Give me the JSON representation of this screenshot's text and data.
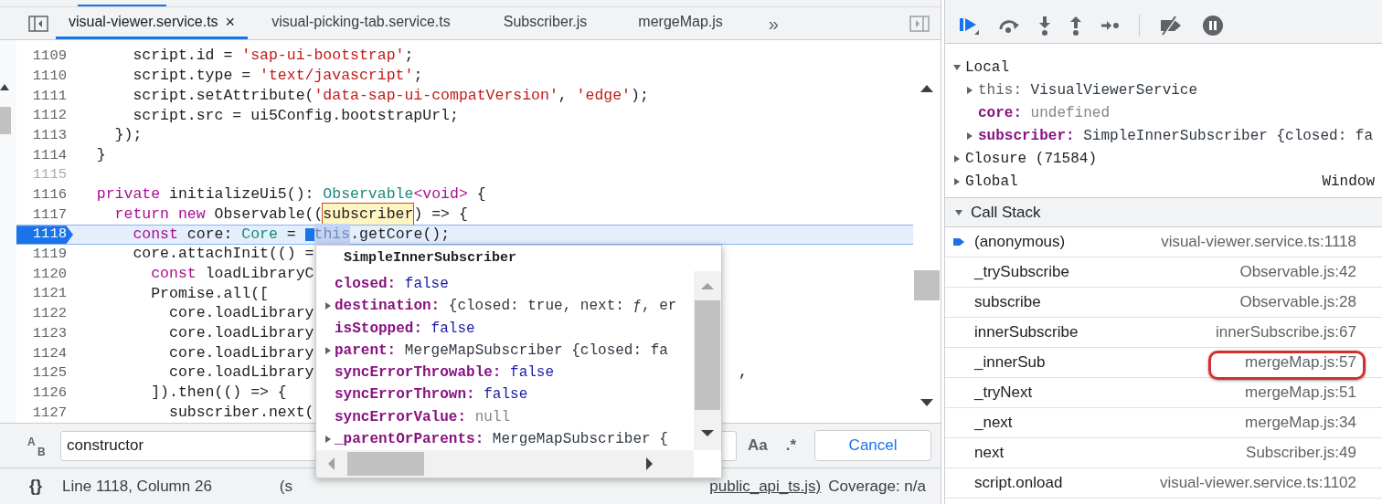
{
  "editor": {
    "tabs": [
      {
        "label": "visual-viewer.service.ts",
        "selected": true,
        "close": "×"
      },
      {
        "label": "visual-picking-tab.service.ts",
        "selected": false
      },
      {
        "label": "Subscriber.js",
        "selected": false
      },
      {
        "label": "mergeMap.js",
        "selected": false
      }
    ],
    "more_tabs": "»",
    "lines": [
      {
        "number": "1109",
        "breakable": true,
        "current": false,
        "tokens": [
          {
            "text": "      script.id = ",
            "kind": "plain"
          },
          {
            "text": "'sap-ui-bootstrap'",
            "kind": "string"
          },
          {
            "text": ";",
            "kind": "plain"
          }
        ]
      },
      {
        "number": "1110",
        "breakable": true,
        "current": false,
        "tokens": [
          {
            "text": "      script.type = ",
            "kind": "plain"
          },
          {
            "text": "'text/javascript'",
            "kind": "string"
          },
          {
            "text": ";",
            "kind": "plain"
          }
        ]
      },
      {
        "number": "1111",
        "breakable": true,
        "current": false,
        "tokens": [
          {
            "text": "      script.setAttribute(",
            "kind": "plain"
          },
          {
            "text": "'data-sap-ui-compatVersion'",
            "kind": "string"
          },
          {
            "text": ", ",
            "kind": "plain"
          },
          {
            "text": "'edge'",
            "kind": "string"
          },
          {
            "text": ");",
            "kind": "plain"
          }
        ]
      },
      {
        "number": "1112",
        "breakable": true,
        "current": false,
        "tokens": [
          {
            "text": "      script.src = ui5Config.bootstrapUrl;",
            "kind": "plain"
          }
        ]
      },
      {
        "number": "1113",
        "breakable": true,
        "current": false,
        "tokens": [
          {
            "text": "    });",
            "kind": "plain"
          }
        ]
      },
      {
        "number": "1114",
        "breakable": true,
        "current": false,
        "tokens": [
          {
            "text": "  }",
            "kind": "plain"
          }
        ]
      },
      {
        "number": "1115",
        "breakable": false,
        "current": false
      },
      {
        "number": "1116",
        "breakable": true,
        "current": false,
        "tokens": [
          {
            "text": "  private",
            "kind": "keyword"
          },
          {
            "text": " initializeUi5(): ",
            "kind": "plain"
          },
          {
            "text": "Observable",
            "kind": "type"
          },
          {
            "text": "<void>",
            "kind": "keyword"
          },
          {
            "text": " {",
            "kind": "plain"
          }
        ]
      },
      {
        "number": "1117",
        "breakable": true,
        "current": false,
        "tokens": [
          {
            "text": "    return new",
            "kind": "keyword"
          },
          {
            "text": " Observable((",
            "kind": "plain"
          },
          {
            "text": "subscriber",
            "kind": "boxed"
          },
          {
            "text": ") => {",
            "kind": "plain"
          }
        ]
      },
      {
        "number": "1118",
        "breakable": true,
        "current": true,
        "tokens": [
          {
            "text": "      const",
            "kind": "keyword"
          },
          {
            "text": " core: ",
            "kind": "plain"
          },
          {
            "text": "Core",
            "kind": "type"
          },
          {
            "text": " = ",
            "kind": "plain"
          },
          {
            "kind": "cursor"
          },
          {
            "text": "this",
            "kind": "selected"
          },
          {
            "text": ".getCore();",
            "kind": "plain"
          }
        ]
      },
      {
        "number": "1119",
        "breakable": true,
        "current": false,
        "tokens": [
          {
            "text": "      core.attachInit(() =",
            "kind": "plain"
          }
        ]
      },
      {
        "number": "1120",
        "breakable": true,
        "current": false,
        "tokens": [
          {
            "text": "        const",
            "kind": "keyword"
          },
          {
            "text": " loadLibraryC",
            "kind": "plain"
          }
        ]
      },
      {
        "number": "1121",
        "breakable": true,
        "current": false,
        "tokens": [
          {
            "text": "        Promise.all([",
            "kind": "plain"
          }
        ]
      },
      {
        "number": "1122",
        "breakable": true,
        "current": false,
        "tokens": [
          {
            "text": "          core.loadLibrary",
            "kind": "plain"
          }
        ]
      },
      {
        "number": "1123",
        "breakable": true,
        "current": false,
        "tokens": [
          {
            "text": "          core.loadLibrary",
            "kind": "plain"
          }
        ]
      },
      {
        "number": "1124",
        "breakable": true,
        "current": false,
        "tokens": [
          {
            "text": "          core.loadLibrary",
            "kind": "plain"
          }
        ]
      },
      {
        "number": "1125",
        "breakable": true,
        "current": false,
        "tokens": [
          {
            "text": "          core.loadLibrary",
            "kind": "plain"
          }
        ],
        "tail": ","
      },
      {
        "number": "1126",
        "breakable": true,
        "current": false,
        "tokens": [
          {
            "text": "        ]).then(() => {",
            "kind": "plain"
          }
        ]
      },
      {
        "number": "1127",
        "breakable": true,
        "current": false,
        "tokens": [
          {
            "text": "          subscriber.next(",
            "kind": "plain"
          }
        ]
      }
    ],
    "popup": {
      "title": "SimpleInnerSubscriber",
      "properties": [
        {
          "key": "closed:",
          "value": "false",
          "expandable": false,
          "kind": "literal"
        },
        {
          "key": "destination:",
          "value": "{closed: true, next: ƒ, er",
          "expandable": true,
          "kind": "object"
        },
        {
          "key": "isStopped:",
          "value": "false",
          "expandable": false,
          "kind": "literal"
        },
        {
          "key": "parent:",
          "value": "MergeMapSubscriber {closed: fa",
          "expandable": true,
          "kind": "object"
        },
        {
          "key": "syncErrorThrowable:",
          "value": "false",
          "expandable": false,
          "kind": "literal"
        },
        {
          "key": "syncErrorThrown:",
          "value": "false",
          "expandable": false,
          "kind": "literal"
        },
        {
          "key": "syncErrorValue:",
          "value": "null",
          "expandable": false,
          "kind": "null"
        },
        {
          "key": "_parentOrParents:",
          "value": "MergeMapSubscriber {",
          "expandable": true,
          "kind": "object"
        }
      ]
    },
    "find_bar": {
      "replace_toggle": {
        "top": "A",
        "bottom": "B"
      },
      "query": "constructor",
      "match_case": "Aa",
      "regex": ".*",
      "cancel": "Cancel"
    },
    "status_bar": {
      "format": "{}",
      "position": "Line 1118, Column 26",
      "source_fragments": [
        "(s",
        "public_api_ts.js)"
      ],
      "coverage": "Coverage: n/a"
    }
  },
  "debugger": {
    "scope": [
      {
        "label": "Local",
        "expanded": true,
        "children": [
          {
            "key": "this:",
            "value": "VisualViewerService",
            "expandable": true,
            "kind": "object"
          },
          {
            "key": "core:",
            "value": "undefined",
            "expandable": false,
            "kind": "null"
          },
          {
            "key": "subscriber:",
            "value": "SimpleInnerSubscriber {closed: fa",
            "expandable": true,
            "kind": "object"
          }
        ]
      },
      {
        "label": "Closure (71584)",
        "expanded": false
      },
      {
        "label": "Global",
        "expanded": false,
        "value": "Window"
      }
    ],
    "call_stack": {
      "title": "Call Stack",
      "expanded": true,
      "frames": [
        {
          "name": "(anonymous)",
          "location": "visual-viewer.service.ts:1118",
          "selected": true,
          "circled": false
        },
        {
          "name": "_trySubscribe",
          "location": "Observable.js:42",
          "selected": false,
          "circled": false
        },
        {
          "name": "subscribe",
          "location": "Observable.js:28",
          "selected": false,
          "circled": false
        },
        {
          "name": "innerSubscribe",
          "location": "innerSubscribe.js:67",
          "selected": false,
          "circled": false
        },
        {
          "name": "_innerSub",
          "location": "mergeMap.js:57",
          "selected": false,
          "circled": true
        },
        {
          "name": "_tryNext",
          "location": "mergeMap.js:51",
          "selected": false,
          "circled": false
        },
        {
          "name": "_next",
          "location": "mergeMap.js:34",
          "selected": false,
          "circled": false
        },
        {
          "name": "next",
          "location": "Subscriber.js:49",
          "selected": false,
          "circled": false
        },
        {
          "name": "script.onload",
          "location": "visual-viewer.service.ts:1102",
          "selected": false,
          "circled": false
        }
      ]
    }
  }
}
